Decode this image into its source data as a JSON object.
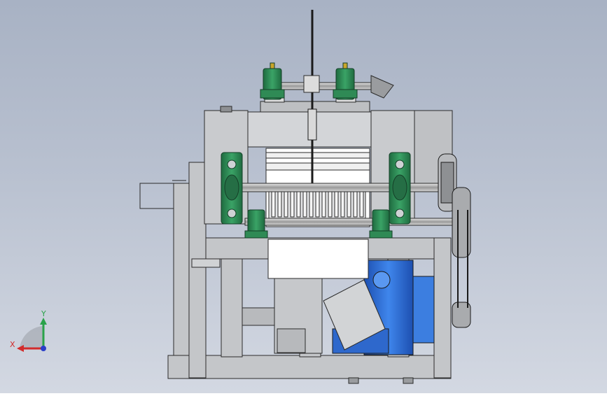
{
  "axes": {
    "x": "X",
    "y": "Y"
  },
  "colors": {
    "background_top": "#a8b2c4",
    "frame_grey": "#c7c9cc",
    "bearing_green": "#2f8a55",
    "motor_blue": "#2f6fd6",
    "outline": "#2b2b2b",
    "x_axis": "#d22b2b",
    "y_axis": "#2aa24a",
    "z_axis": "#2a3fc8"
  }
}
